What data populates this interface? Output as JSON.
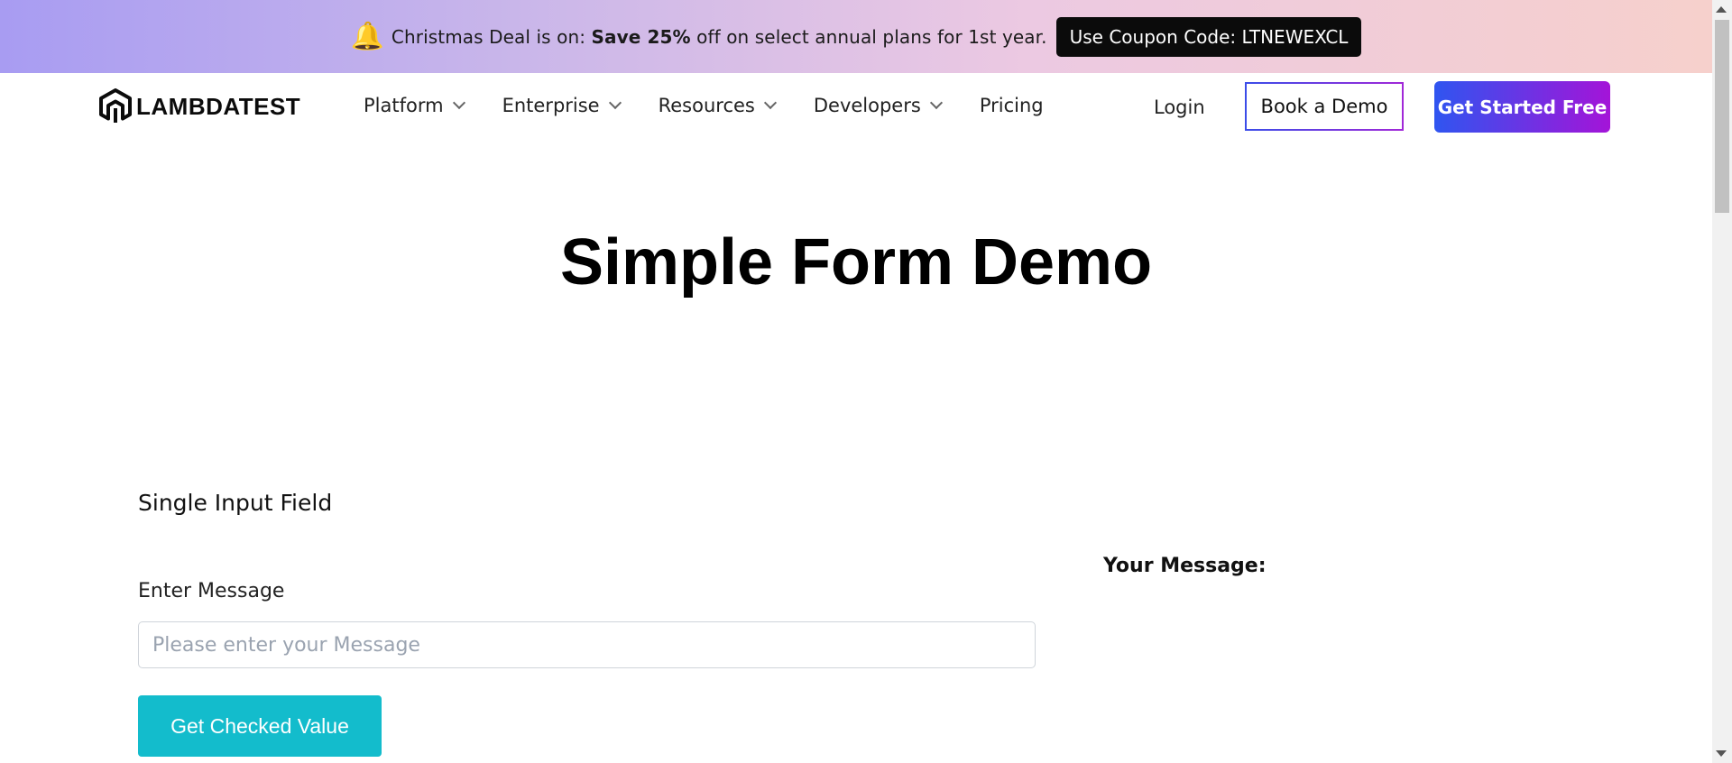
{
  "promo": {
    "icon": "gift-bell-icon",
    "text_prefix": "Christmas Deal is on: ",
    "text_bold": "Save 25%",
    "text_suffix": " off on select annual plans for 1st year.",
    "coupon": "Use Coupon Code: LTNEWEXCL"
  },
  "nav": {
    "logo_text": "LAMBDATEST",
    "menu": [
      {
        "label": "Platform",
        "dropdown": true
      },
      {
        "label": "Enterprise",
        "dropdown": true
      },
      {
        "label": "Resources",
        "dropdown": true
      },
      {
        "label": "Developers",
        "dropdown": true
      },
      {
        "label": "Pricing",
        "dropdown": false
      }
    ],
    "login": "Login",
    "book_demo": "Book a Demo",
    "get_started": "Get Started Free"
  },
  "main": {
    "title": "Simple Form Demo",
    "section_title": "Single Input Field",
    "field_label": "Enter Message",
    "input_placeholder": "Please enter your Message",
    "input_value": "",
    "button_label": "Get Checked Value",
    "output_label": "Your Message:"
  },
  "colors": {
    "accent_button": "#13bccc",
    "cta_gradient_start": "#2f55f0",
    "cta_gradient_end": "#a414d8"
  }
}
